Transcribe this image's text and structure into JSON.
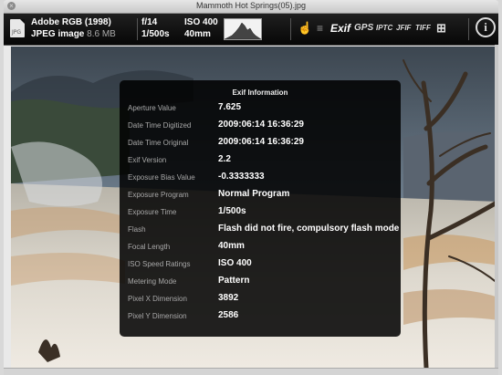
{
  "window": {
    "title": "Mammoth Hot Springs(05).jpg"
  },
  "toolbar": {
    "file_icon_label": "JPG",
    "color_profile": "Adobe RGB (1998)",
    "format": "JPEG image",
    "file_size": "8.6 MB",
    "aperture": "f/14",
    "shutter": "1/500s",
    "iso": "ISO 400",
    "focal": "40mm",
    "hand_glyph": "☝",
    "list_glyph": "≡",
    "tabs": [
      "Exif",
      "GPS",
      "IPTC",
      "JFIF",
      "TIFF"
    ],
    "grid_glyph": "⊞",
    "info_glyph": "i"
  },
  "exif": {
    "title": "Exif Information",
    "rows": [
      {
        "key": "Aperture Value",
        "value": "7.625"
      },
      {
        "key": "Date Time Digitized",
        "value": "2009:06:14 16:36:29"
      },
      {
        "key": "Date Time Original",
        "value": "2009:06:14 16:36:29"
      },
      {
        "key": "Exif Version",
        "value": "2.2"
      },
      {
        "key": "Exposure Bias Value",
        "value": "-0.3333333"
      },
      {
        "key": "Exposure Program",
        "value": "Normal Program"
      },
      {
        "key": "Exposure Time",
        "value": "1/500s"
      },
      {
        "key": "Flash",
        "value": "Flash did not fire, compulsory flash mode"
      },
      {
        "key": "Focal Length",
        "value": "40mm"
      },
      {
        "key": "ISO Speed Ratings",
        "value": "ISO 400"
      },
      {
        "key": "Metering Mode",
        "value": "Pattern"
      },
      {
        "key": "Pixel X Dimension",
        "value": "3892"
      },
      {
        "key": "Pixel Y Dimension",
        "value": "2586"
      }
    ]
  }
}
